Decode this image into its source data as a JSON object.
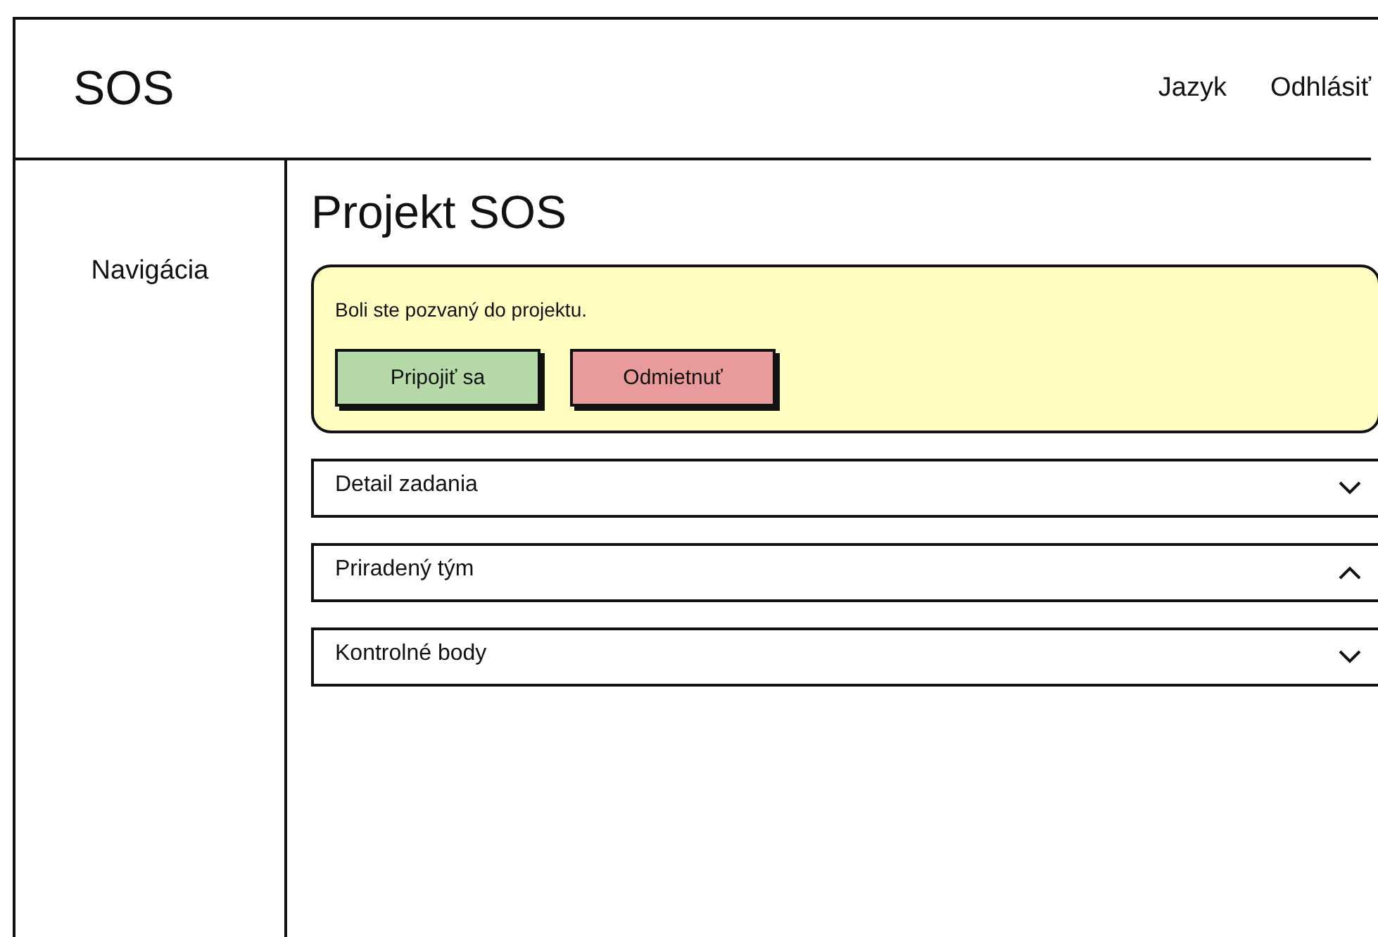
{
  "header": {
    "logo": "SOS",
    "links": [
      "Jazyk",
      "Odhlásiť"
    ]
  },
  "sidebar": {
    "title": "Navigácia"
  },
  "page": {
    "title": "Projekt SOS"
  },
  "invitation": {
    "message": "Boli ste pozvaný do projektu.",
    "buttons": [
      {
        "label": "Pripojiť sa",
        "kind": "accept"
      },
      {
        "label": "Odmietnuť",
        "kind": "decline"
      }
    ]
  },
  "sections": [
    {
      "title": "Detail zadania",
      "expanded": false
    },
    {
      "title": "Priradený tým",
      "expanded": true
    },
    {
      "title": "Kontrolné body",
      "expanded": false
    }
  ]
}
